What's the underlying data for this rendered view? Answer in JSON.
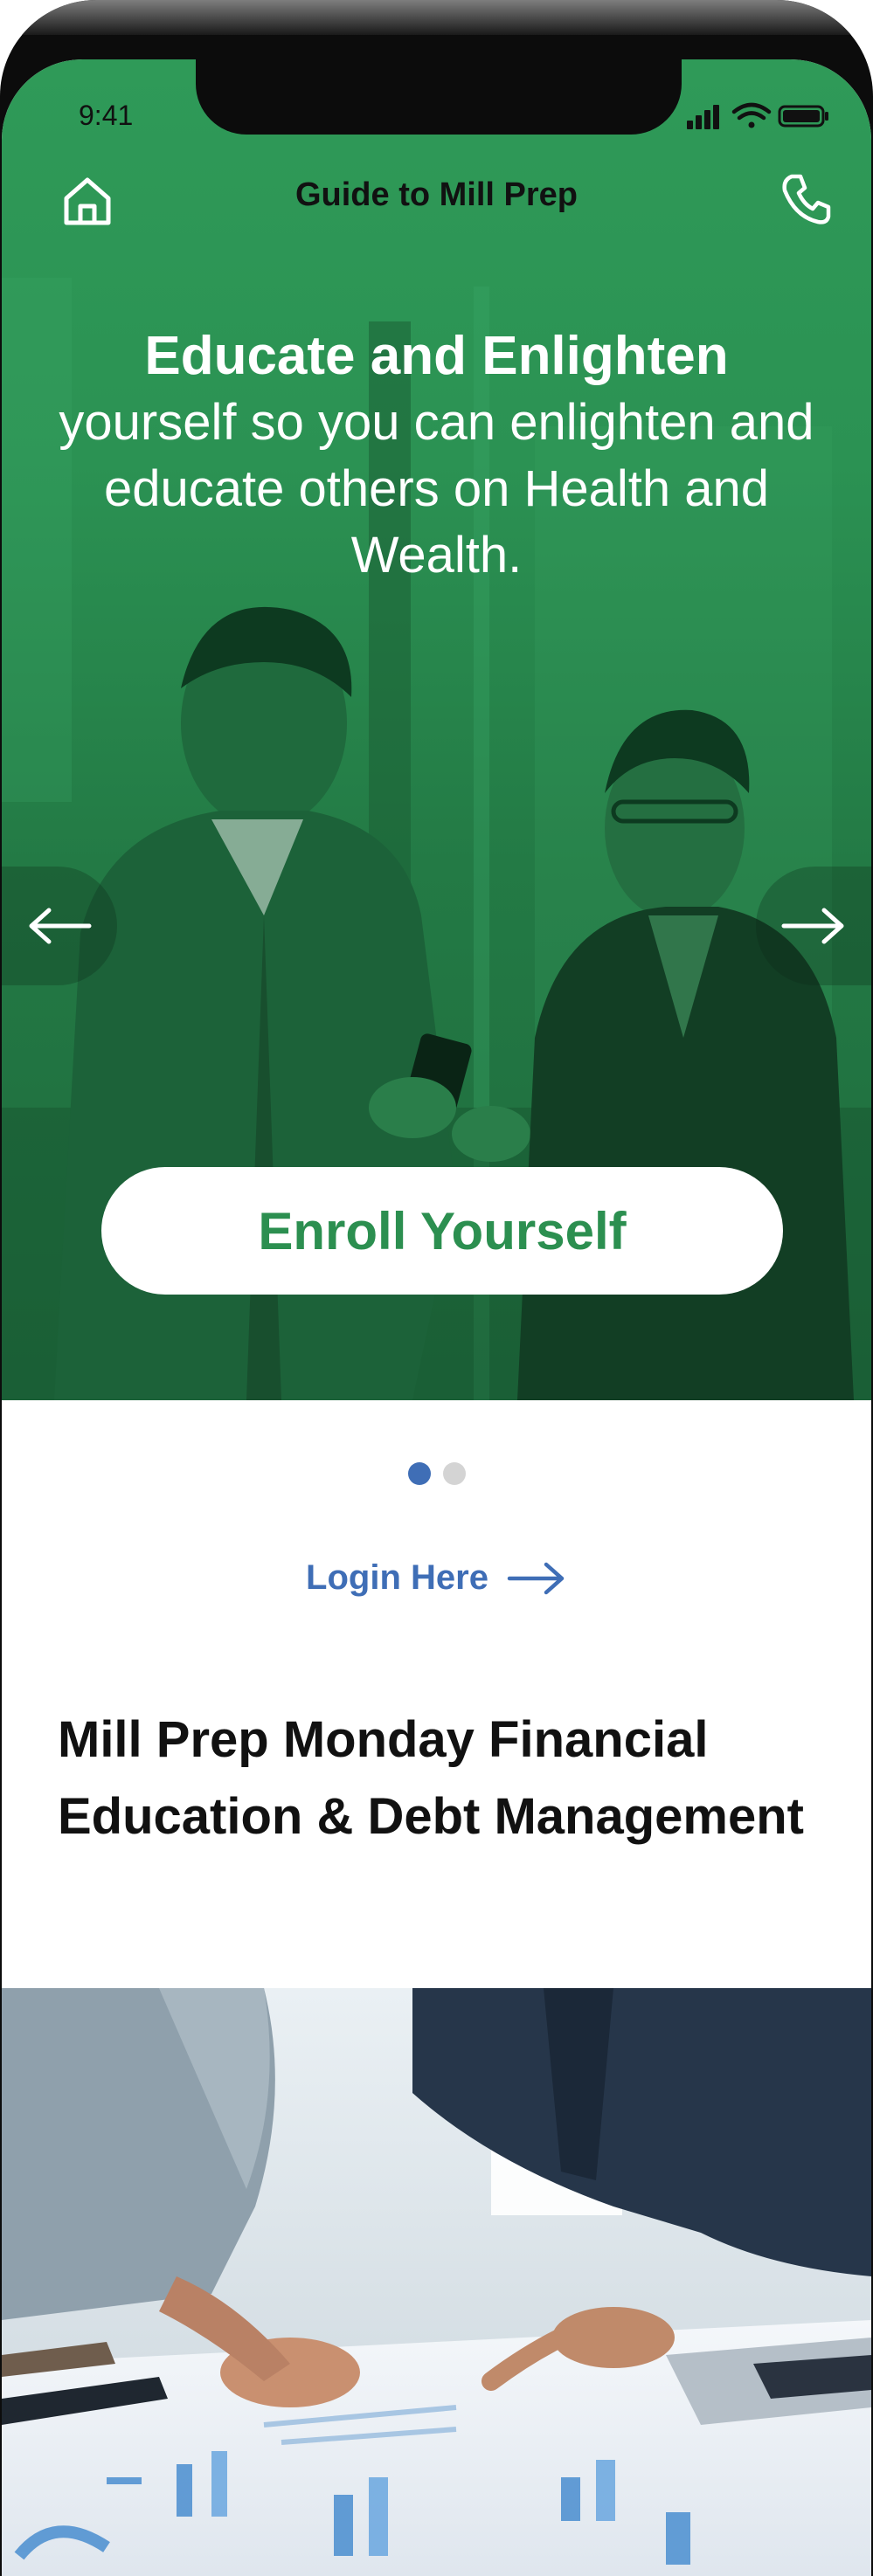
{
  "status_bar": {
    "time": "9:41"
  },
  "nav": {
    "title": "Guide to Mill Prep"
  },
  "hero": {
    "headline_bold": "Educate and Enlighten",
    "headline_rest": "yourself so you can enlighten and educate others on Health and Wealth.",
    "enroll_label": "Enroll Yourself",
    "slide_count": 2,
    "active_slide": 1
  },
  "login": {
    "label": "Login Here"
  },
  "section": {
    "title": "Mill Prep Monday Financial Education & Debt Management"
  },
  "colors": {
    "brand_green": "#2c8f50",
    "link_blue": "#3f6eb6",
    "dot_inactive": "#d4d4d4"
  },
  "icons": {
    "home": "home-icon",
    "phone": "phone-icon",
    "prev": "arrow-left-icon",
    "next": "arrow-right-icon",
    "login": "arrow-right-icon"
  }
}
